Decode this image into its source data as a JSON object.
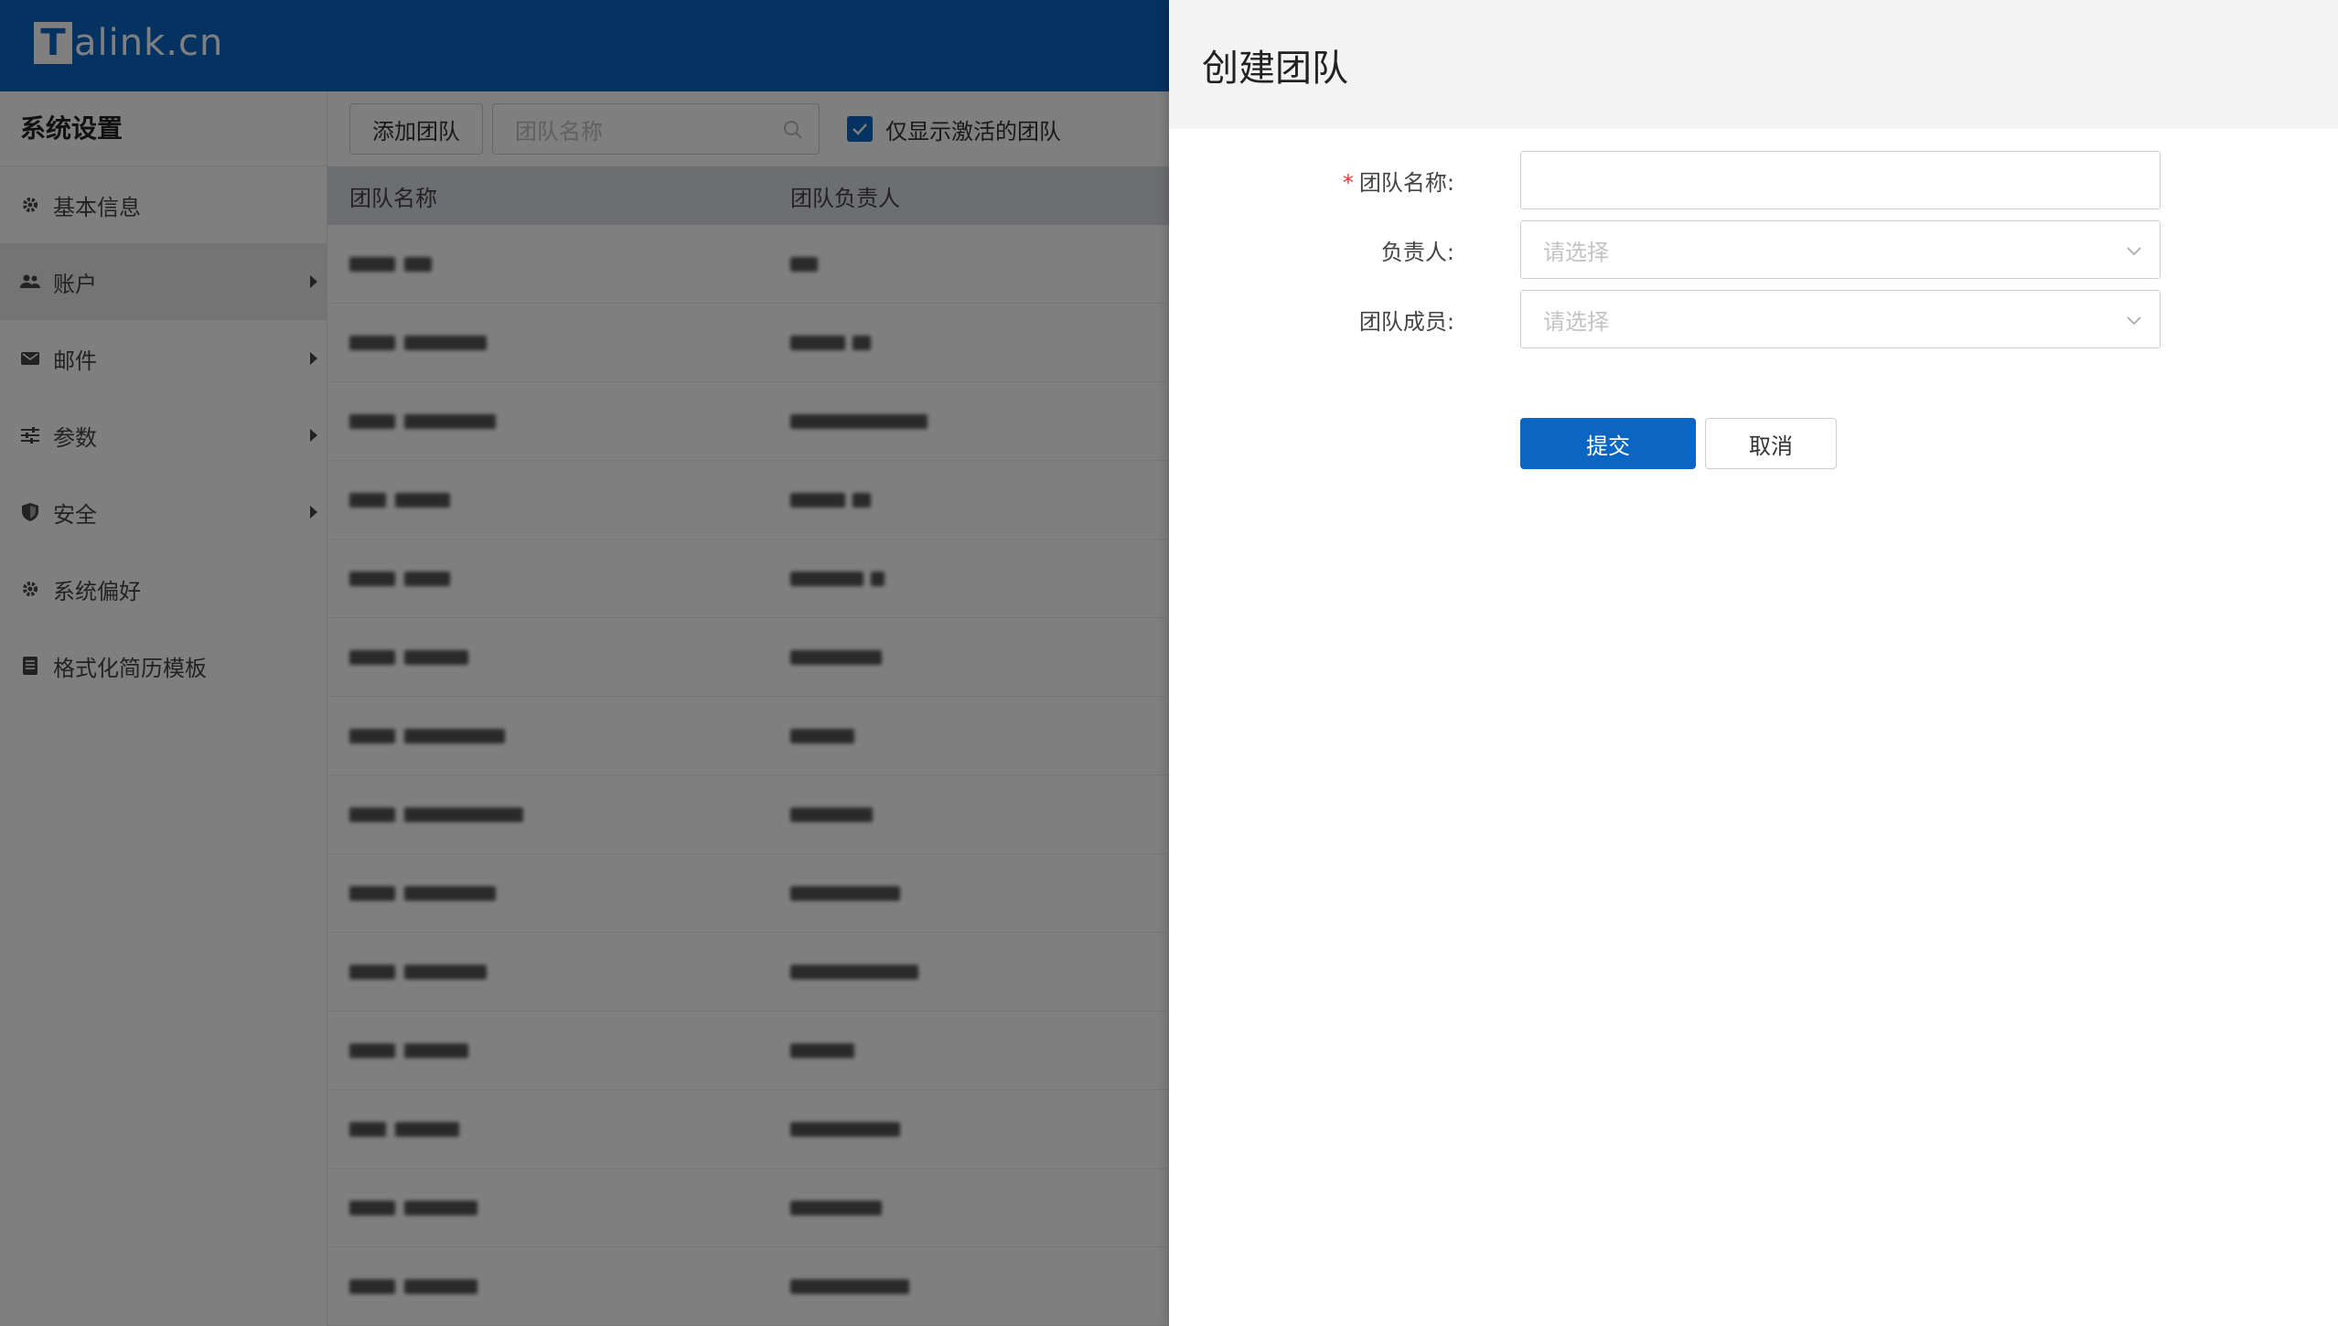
{
  "header": {
    "logo_letter": "T",
    "logo_rest": "alink.cn"
  },
  "sidebar": {
    "title": "系统设置",
    "items": [
      {
        "label": "基本信息",
        "icon": "gear-icon",
        "has_arrow": false,
        "active": false
      },
      {
        "label": "账户",
        "icon": "users-icon",
        "has_arrow": true,
        "active": true
      },
      {
        "label": "邮件",
        "icon": "mail-icon",
        "has_arrow": true,
        "active": false
      },
      {
        "label": "参数",
        "icon": "sliders-icon",
        "has_arrow": true,
        "active": false
      },
      {
        "label": "安全",
        "icon": "shield-icon",
        "has_arrow": true,
        "active": false
      },
      {
        "label": "系统偏好",
        "icon": "gear-icon",
        "has_arrow": false,
        "active": false
      },
      {
        "label": "格式化简历模板",
        "icon": "document-icon",
        "has_arrow": false,
        "active": false
      }
    ]
  },
  "toolbar": {
    "add_label": "添加团队",
    "search_placeholder": "团队名称",
    "active_only_label": "仅显示激活的团队",
    "active_only_checked": true
  },
  "table": {
    "columns": [
      "团队名称",
      "团队负责人"
    ]
  },
  "drawer": {
    "title": "创建团队",
    "fields": {
      "name_label": "团队名称:",
      "name_value": "",
      "owner_label": "负责人:",
      "owner_placeholder": "请选择",
      "members_label": "团队成员:",
      "members_placeholder": "请选择"
    },
    "submit_label": "提交",
    "cancel_label": "取消"
  },
  "colors": {
    "primary": "#0a66c2",
    "required": "#e53935"
  }
}
